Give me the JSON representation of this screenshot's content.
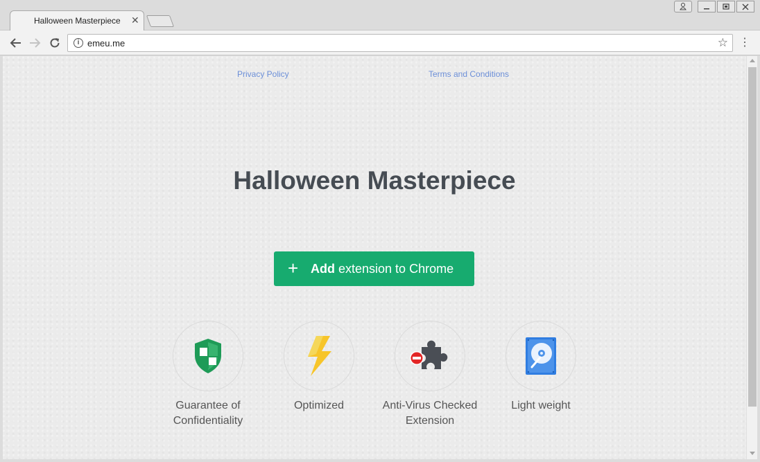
{
  "browser": {
    "tab_title": "Halloween Masterpiece",
    "tab_close": "✕",
    "url": "emeu.me"
  },
  "page": {
    "links": {
      "privacy": "Privacy Policy",
      "terms": "Terms and Conditions"
    },
    "headline": "Halloween Masterpiece",
    "cta": {
      "plus": "+",
      "bold": "Add",
      "rest": " extension to Chrome"
    },
    "features": [
      {
        "label_line1": "Guarantee of",
        "label_line2": "Confidentiality",
        "icon": "shield-icon"
      },
      {
        "label_line1": "Optimized",
        "label_line2": "",
        "icon": "lightning-icon"
      },
      {
        "label_line1": "Anti-Virus Checked",
        "label_line2": "Extension",
        "icon": "puzzle-icon"
      },
      {
        "label_line1": "Light weight",
        "label_line2": "",
        "icon": "hard-drive-icon"
      }
    ]
  },
  "colors": {
    "cta_green": "#17ab6f",
    "headline": "#464c53",
    "link": "#6c8fd8"
  }
}
